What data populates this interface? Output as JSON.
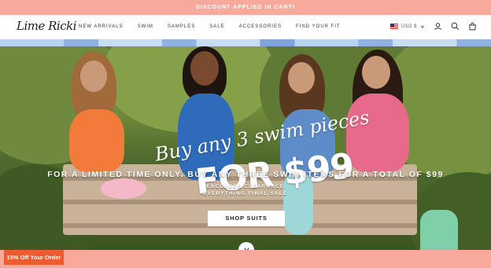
{
  "announcement": {
    "text": "DISCOUNT APPLIED IN CART!"
  },
  "header": {
    "logo": "Lime Ricki",
    "nav": [
      "NEW ARRIVALS",
      "SWIM",
      "SAMPLES",
      "SALE",
      "ACCESSORIES",
      "FIND YOUR FIT"
    ],
    "currency": "USD $"
  },
  "hero": {
    "script_line": "Buy any 3 swim pieces",
    "price_line": "FOR $99",
    "subtitle": "FOR A LIMITED TIME ONLY. BUY ANY THREE SWIM ITEMS FOR A TOTAL OF $99",
    "note1": "EXCLUDES CLEARANCE",
    "note2": "EVERYTHING FINAL SALE",
    "cta": "SHOP SUITS",
    "scroll_icon": "chevron-down-icon"
  },
  "promo": {
    "label": "15% Off Your Order"
  },
  "colors": {
    "accent": "#f7a99c",
    "promo": "#ee5b2e"
  }
}
